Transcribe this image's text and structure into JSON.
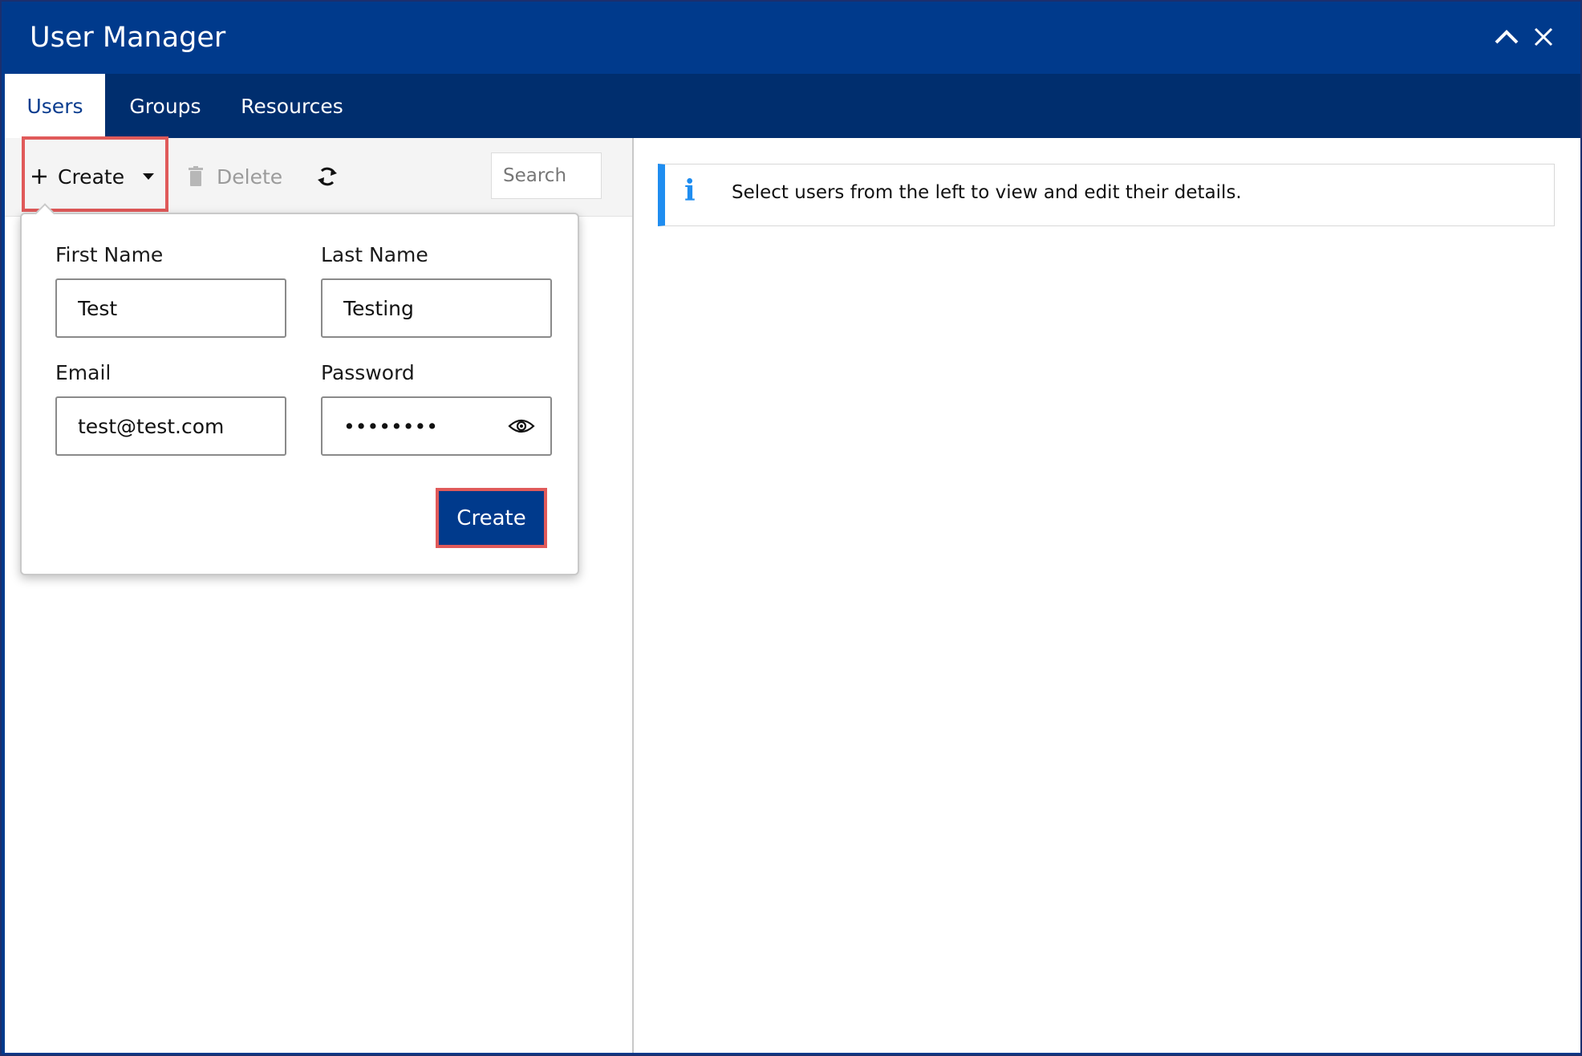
{
  "window": {
    "title": "User Manager"
  },
  "tabs": [
    {
      "label": "Users",
      "active": true
    },
    {
      "label": "Groups",
      "active": false
    },
    {
      "label": "Resources",
      "active": false
    }
  ],
  "toolbar": {
    "create_label": "Create",
    "delete_label": "Delete",
    "search_placeholder": "Search"
  },
  "create_form": {
    "first_name_label": "First Name",
    "first_name_value": "Test",
    "last_name_label": "Last Name",
    "last_name_value": "Testing",
    "email_label": "Email",
    "email_value": "test@test.com",
    "password_label": "Password",
    "password_value": "••••••••",
    "submit_label": "Create"
  },
  "info": {
    "message": "Select users from the left to view and edit their details."
  },
  "colors": {
    "header": "#003a8c",
    "tabbar": "#002e6e",
    "accent_info": "#1f8df0",
    "highlight": "#e05a5a"
  }
}
